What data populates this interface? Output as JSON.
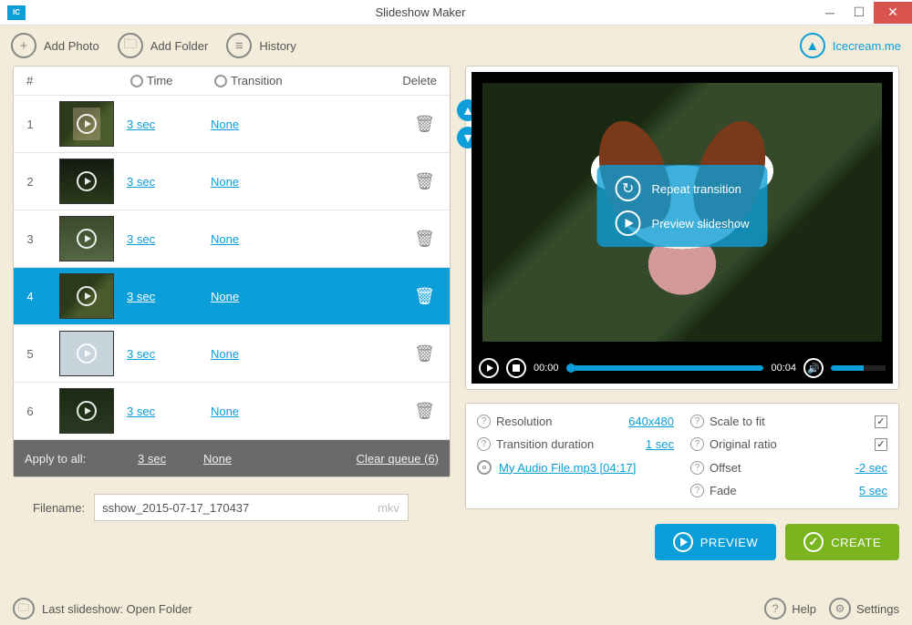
{
  "window": {
    "title": "Slideshow Maker"
  },
  "toolbar": {
    "add_photo": "Add Photo",
    "add_folder": "Add Folder",
    "history": "History",
    "brand": "Icecream.me"
  },
  "headers": {
    "index": "#",
    "time": "Time",
    "transition": "Transition",
    "delete": "Delete"
  },
  "rows": [
    {
      "n": "1",
      "time": "3 sec",
      "transition": "None"
    },
    {
      "n": "2",
      "time": "3 sec",
      "transition": "None"
    },
    {
      "n": "3",
      "time": "3 sec",
      "transition": "None"
    },
    {
      "n": "4",
      "time": "3 sec",
      "transition": "None"
    },
    {
      "n": "5",
      "time": "3 sec",
      "transition": "None"
    },
    {
      "n": "6",
      "time": "3 sec",
      "transition": "None"
    }
  ],
  "apply_all": {
    "label": "Apply to all:",
    "time": "3 sec",
    "transition": "None",
    "clear": "Clear queue (6)"
  },
  "filename": {
    "label": "Filename:",
    "value": "sshow_2015-07-17_170437",
    "ext": "mkv"
  },
  "overlay": {
    "repeat": "Repeat transition",
    "preview": "Preview slideshow"
  },
  "player": {
    "t1": "00:00",
    "t2": "00:04"
  },
  "settings": {
    "resolution_label": "Resolution",
    "resolution_value": "640x480",
    "transition_label": "Transition duration",
    "transition_value": "1 sec",
    "scale_label": "Scale to fit",
    "ratio_label": "Original ratio",
    "offset_label": "Offset",
    "offset_value": "-2 sec",
    "fade_label": "Fade",
    "fade_value": "5 sec",
    "audio": "My Audio File.mp3 [04:17]"
  },
  "actions": {
    "preview": "PREVIEW",
    "create": "CREATE"
  },
  "footer": {
    "last": "Last slideshow: Open Folder",
    "help": "Help",
    "settings": "Settings"
  }
}
